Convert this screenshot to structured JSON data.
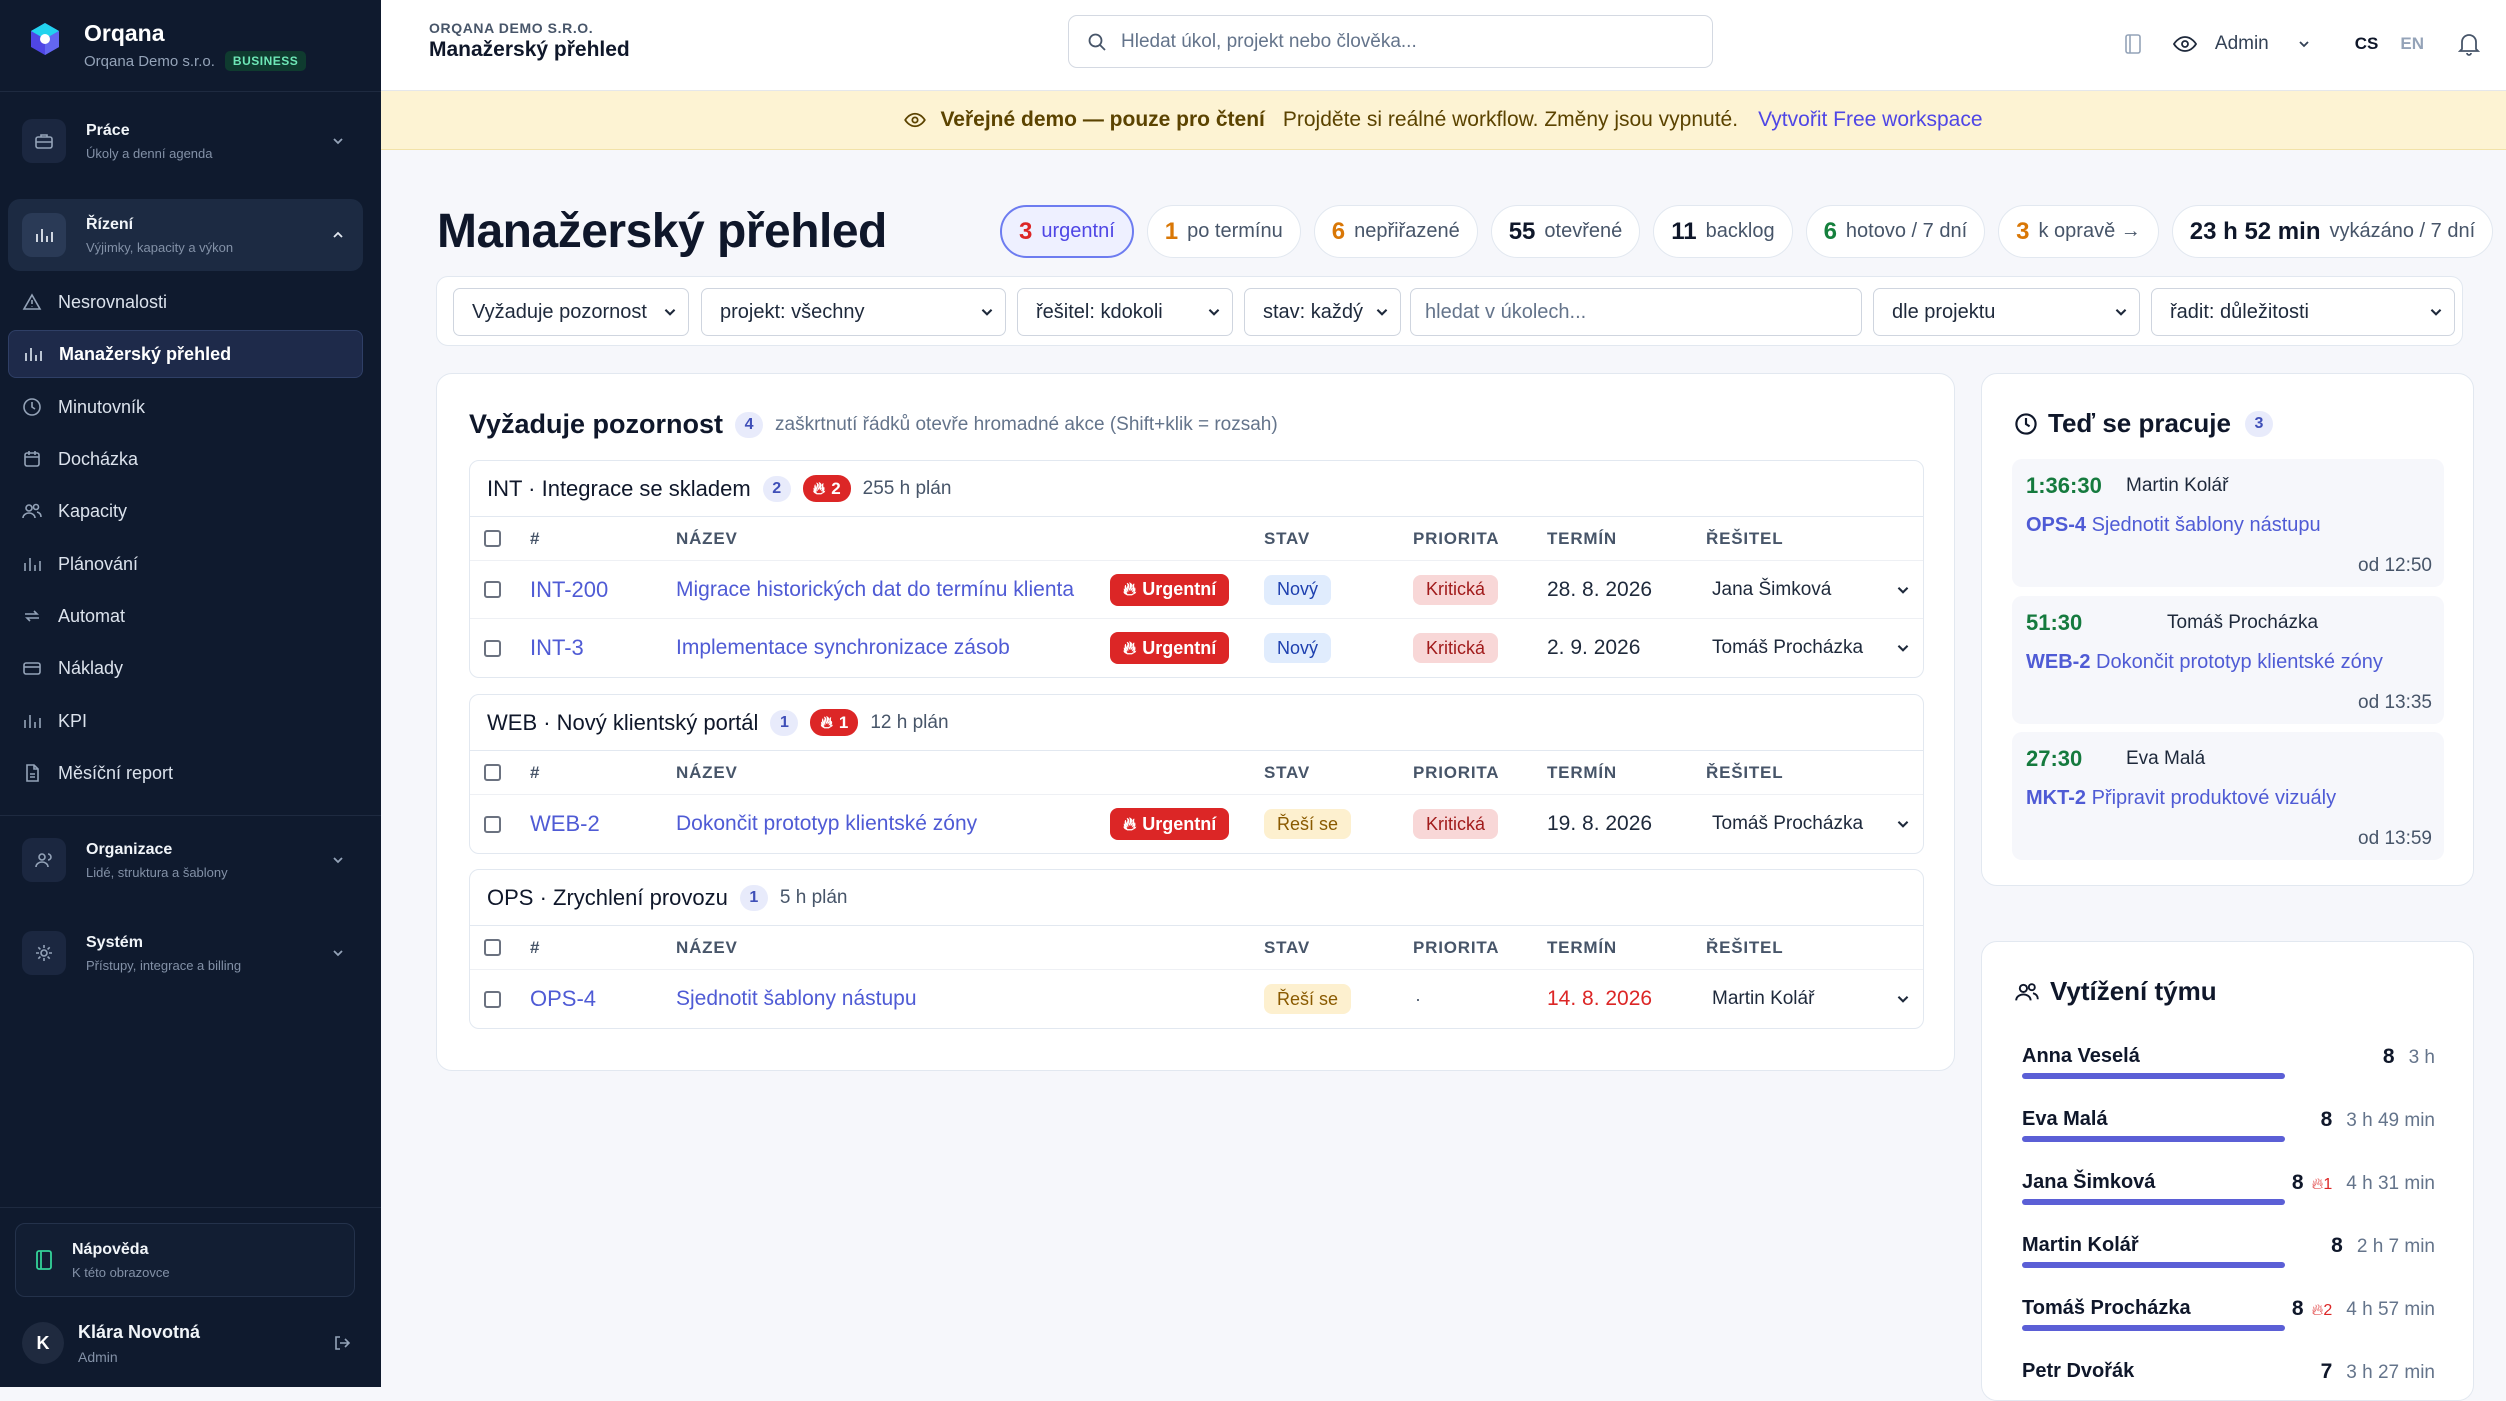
{
  "brand": {
    "name": "Orqana",
    "org": "Orqana Demo s.r.o.",
    "plan": "BUSINESS"
  },
  "sidebar": {
    "sections": [
      {
        "title": "Práce",
        "subtitle": "Úkoly a denní agenda"
      },
      {
        "title": "Řízení",
        "subtitle": "Výjimky, kapacity a výkon"
      },
      {
        "title": "Organizace",
        "subtitle": "Lidé, struktura a šablony"
      },
      {
        "title": "Systém",
        "subtitle": "Přístupy, integrace a billing"
      }
    ],
    "items": [
      {
        "label": "Nesrovnalosti",
        "icon": "warning-icon"
      },
      {
        "label": "Manažerský přehled",
        "icon": "bar-chart-icon"
      },
      {
        "label": "Minutovník",
        "icon": "clock-icon"
      },
      {
        "label": "Docházka",
        "icon": "calendar-icon"
      },
      {
        "label": "Kapacity",
        "icon": "users-icon"
      },
      {
        "label": "Plánování",
        "icon": "bar-chart-icon"
      },
      {
        "label": "Automat",
        "icon": "repeat-icon"
      },
      {
        "label": "Náklady",
        "icon": "wallet-icon"
      },
      {
        "label": "KPI",
        "icon": "bar-chart-icon"
      },
      {
        "label": "Měsíční report",
        "icon": "document-icon"
      }
    ],
    "help": {
      "title": "Nápověda",
      "subtitle": "K této obrazovce"
    },
    "user": {
      "initial": "K",
      "name": "Klára Novotná",
      "role": "Admin"
    }
  },
  "topbar": {
    "org": "ORQANA DEMO S.R.O.",
    "title": "Manažerský přehled",
    "search_placeholder": "Hledat úkol, projekt nebo člověka...",
    "role": "Admin",
    "lang_cs": "CS",
    "lang_en": "EN"
  },
  "banner": {
    "title": "Veřejné demo — pouze pro čtení",
    "text": "Projděte si reálné workflow. Změny jsou vypnuté.",
    "link": "Vytvořit Free workspace"
  },
  "page": {
    "title": "Manažerský přehled"
  },
  "stats": [
    {
      "value": "3",
      "label": "urgentní",
      "color": "#dc2626"
    },
    {
      "value": "1",
      "label": "po termínu",
      "color": "#d97706"
    },
    {
      "value": "6",
      "label": "nepřiřazené",
      "color": "#d97706"
    },
    {
      "value": "55",
      "label": "otevřené",
      "color": "#0f172a"
    },
    {
      "value": "11",
      "label": "backlog",
      "color": "#0f172a"
    },
    {
      "value": "6",
      "label": "hotovo / 7 dní",
      "color": "#15803d"
    },
    {
      "value": "3",
      "label": "k opravě →",
      "color": "#d97706"
    },
    {
      "value": "23 h 52 min",
      "label": "vykázáno / 7 dní",
      "color": "#0f172a"
    }
  ],
  "filters": {
    "view": "Vyžaduje pozornost",
    "project": "projekt: všechny",
    "assignee": "řešitel: kdokoli",
    "state": "stav: každý",
    "search_placeholder": "hledat v úkolech...",
    "group": "dle projektu",
    "sort": "řadit: důležitosti"
  },
  "attention": {
    "title": "Vyžaduje pozornost",
    "count": "4",
    "hint": "zaškrtnutí řádků otevře hromadné akce (Shift+klik = rozsah)",
    "columns": {
      "id": "#",
      "name": "NÁZEV",
      "state": "STAV",
      "priority": "PRIORITA",
      "due": "TERMÍN",
      "assignee": "ŘEŠITEL"
    },
    "groups": [
      {
        "title": "INT · Integrace se skladem",
        "count": "2",
        "fire": "2",
        "plan": "255 h plán",
        "rows": [
          {
            "id": "INT-200",
            "name": "Migrace historických dat do termínu klienta",
            "urgent": "Urgentní",
            "state": "Nový",
            "state_kind": "new",
            "priority": "Kritická",
            "due": "28. 8. 2026",
            "late": false,
            "assignee": "Jana Šimková"
          },
          {
            "id": "INT-3",
            "name": "Implementace synchronizace zásob",
            "urgent": "Urgentní",
            "state": "Nový",
            "state_kind": "new",
            "priority": "Kritická",
            "due": "2. 9. 2026",
            "late": false,
            "assignee": "Tomáš Procházka"
          }
        ]
      },
      {
        "title": "WEB · Nový klientský portál",
        "count": "1",
        "fire": "1",
        "plan": "12 h plán",
        "rows": [
          {
            "id": "WEB-2",
            "name": "Dokončit prototyp klientské zóny",
            "urgent": "Urgentní",
            "state": "Řeší se",
            "state_kind": "wip",
            "priority": "Kritická",
            "due": "19. 8. 2026",
            "late": false,
            "assignee": "Tomáš Procházka"
          }
        ]
      },
      {
        "title": "OPS · Zrychlení provozu",
        "count": "1",
        "fire": "",
        "plan": "5 h plán",
        "rows": [
          {
            "id": "OPS-4",
            "name": "Sjednotit šablony nástupu",
            "urgent": "",
            "state": "Řeší se",
            "state_kind": "wip",
            "priority": "·",
            "due": "14. 8. 2026",
            "late": true,
            "assignee": "Martin Kolář"
          }
        ]
      }
    ]
  },
  "working": {
    "title": "Teď se pracuje",
    "count": "3",
    "items": [
      {
        "time": "1:36:30",
        "person": "Martin Kolář",
        "task_id": "OPS-4",
        "task": "Sjednotit šablony nástupu",
        "since": "od 12:50"
      },
      {
        "time": "51:30",
        "person": "Tomáš Procházka",
        "task_id": "WEB-2",
        "task": "Dokončit prototyp klientské zóny",
        "since": "od 13:35"
      },
      {
        "time": "27:30",
        "person": "Eva Malá",
        "task_id": "MKT-2",
        "task": "Připravit produktové vizuály",
        "since": "od 13:59"
      }
    ]
  },
  "team": {
    "title": "Vytížení týmu",
    "members": [
      {
        "name": "Anna Veselá",
        "count": "8",
        "fire": "",
        "hours": "3 h"
      },
      {
        "name": "Eva Malá",
        "count": "8",
        "fire": "",
        "hours": "3 h 49 min"
      },
      {
        "name": "Jana Šimková",
        "count": "8",
        "fire": "1",
        "hours": "4 h 31 min"
      },
      {
        "name": "Martin Kolář",
        "count": "8",
        "fire": "",
        "hours": "2 h 7 min"
      },
      {
        "name": "Tomáš Procházka",
        "count": "8",
        "fire": "2",
        "hours": "4 h 57 min"
      },
      {
        "name": "Petr Dvořák",
        "count": "7",
        "fire": "",
        "hours": "3 h 27 min"
      }
    ]
  }
}
